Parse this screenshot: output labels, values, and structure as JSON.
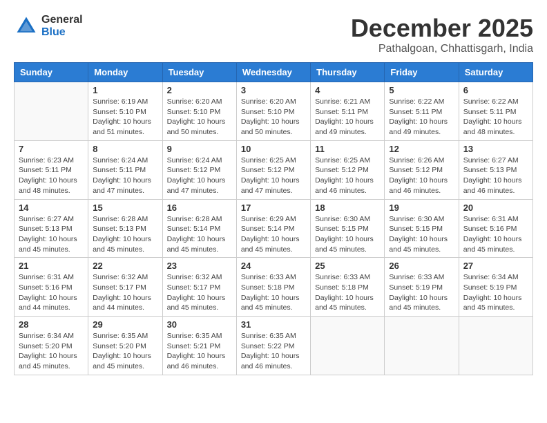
{
  "header": {
    "logo_general": "General",
    "logo_blue": "Blue",
    "month_title": "December 2025",
    "location": "Pathalgoan, Chhattisgarh, India"
  },
  "days_of_week": [
    "Sunday",
    "Monday",
    "Tuesday",
    "Wednesday",
    "Thursday",
    "Friday",
    "Saturday"
  ],
  "weeks": [
    [
      {
        "day": "",
        "info": ""
      },
      {
        "day": "1",
        "info": "Sunrise: 6:19 AM\nSunset: 5:10 PM\nDaylight: 10 hours\nand 51 minutes."
      },
      {
        "day": "2",
        "info": "Sunrise: 6:20 AM\nSunset: 5:10 PM\nDaylight: 10 hours\nand 50 minutes."
      },
      {
        "day": "3",
        "info": "Sunrise: 6:20 AM\nSunset: 5:10 PM\nDaylight: 10 hours\nand 50 minutes."
      },
      {
        "day": "4",
        "info": "Sunrise: 6:21 AM\nSunset: 5:11 PM\nDaylight: 10 hours\nand 49 minutes."
      },
      {
        "day": "5",
        "info": "Sunrise: 6:22 AM\nSunset: 5:11 PM\nDaylight: 10 hours\nand 49 minutes."
      },
      {
        "day": "6",
        "info": "Sunrise: 6:22 AM\nSunset: 5:11 PM\nDaylight: 10 hours\nand 48 minutes."
      }
    ],
    [
      {
        "day": "7",
        "info": "Sunrise: 6:23 AM\nSunset: 5:11 PM\nDaylight: 10 hours\nand 48 minutes."
      },
      {
        "day": "8",
        "info": "Sunrise: 6:24 AM\nSunset: 5:11 PM\nDaylight: 10 hours\nand 47 minutes."
      },
      {
        "day": "9",
        "info": "Sunrise: 6:24 AM\nSunset: 5:12 PM\nDaylight: 10 hours\nand 47 minutes."
      },
      {
        "day": "10",
        "info": "Sunrise: 6:25 AM\nSunset: 5:12 PM\nDaylight: 10 hours\nand 47 minutes."
      },
      {
        "day": "11",
        "info": "Sunrise: 6:25 AM\nSunset: 5:12 PM\nDaylight: 10 hours\nand 46 minutes."
      },
      {
        "day": "12",
        "info": "Sunrise: 6:26 AM\nSunset: 5:12 PM\nDaylight: 10 hours\nand 46 minutes."
      },
      {
        "day": "13",
        "info": "Sunrise: 6:27 AM\nSunset: 5:13 PM\nDaylight: 10 hours\nand 46 minutes."
      }
    ],
    [
      {
        "day": "14",
        "info": "Sunrise: 6:27 AM\nSunset: 5:13 PM\nDaylight: 10 hours\nand 45 minutes."
      },
      {
        "day": "15",
        "info": "Sunrise: 6:28 AM\nSunset: 5:13 PM\nDaylight: 10 hours\nand 45 minutes."
      },
      {
        "day": "16",
        "info": "Sunrise: 6:28 AM\nSunset: 5:14 PM\nDaylight: 10 hours\nand 45 minutes."
      },
      {
        "day": "17",
        "info": "Sunrise: 6:29 AM\nSunset: 5:14 PM\nDaylight: 10 hours\nand 45 minutes."
      },
      {
        "day": "18",
        "info": "Sunrise: 6:30 AM\nSunset: 5:15 PM\nDaylight: 10 hours\nand 45 minutes."
      },
      {
        "day": "19",
        "info": "Sunrise: 6:30 AM\nSunset: 5:15 PM\nDaylight: 10 hours\nand 45 minutes."
      },
      {
        "day": "20",
        "info": "Sunrise: 6:31 AM\nSunset: 5:16 PM\nDaylight: 10 hours\nand 45 minutes."
      }
    ],
    [
      {
        "day": "21",
        "info": "Sunrise: 6:31 AM\nSunset: 5:16 PM\nDaylight: 10 hours\nand 44 minutes."
      },
      {
        "day": "22",
        "info": "Sunrise: 6:32 AM\nSunset: 5:17 PM\nDaylight: 10 hours\nand 44 minutes."
      },
      {
        "day": "23",
        "info": "Sunrise: 6:32 AM\nSunset: 5:17 PM\nDaylight: 10 hours\nand 45 minutes."
      },
      {
        "day": "24",
        "info": "Sunrise: 6:33 AM\nSunset: 5:18 PM\nDaylight: 10 hours\nand 45 minutes."
      },
      {
        "day": "25",
        "info": "Sunrise: 6:33 AM\nSunset: 5:18 PM\nDaylight: 10 hours\nand 45 minutes."
      },
      {
        "day": "26",
        "info": "Sunrise: 6:33 AM\nSunset: 5:19 PM\nDaylight: 10 hours\nand 45 minutes."
      },
      {
        "day": "27",
        "info": "Sunrise: 6:34 AM\nSunset: 5:19 PM\nDaylight: 10 hours\nand 45 minutes."
      }
    ],
    [
      {
        "day": "28",
        "info": "Sunrise: 6:34 AM\nSunset: 5:20 PM\nDaylight: 10 hours\nand 45 minutes."
      },
      {
        "day": "29",
        "info": "Sunrise: 6:35 AM\nSunset: 5:20 PM\nDaylight: 10 hours\nand 45 minutes."
      },
      {
        "day": "30",
        "info": "Sunrise: 6:35 AM\nSunset: 5:21 PM\nDaylight: 10 hours\nand 46 minutes."
      },
      {
        "day": "31",
        "info": "Sunrise: 6:35 AM\nSunset: 5:22 PM\nDaylight: 10 hours\nand 46 minutes."
      },
      {
        "day": "",
        "info": ""
      },
      {
        "day": "",
        "info": ""
      },
      {
        "day": "",
        "info": ""
      }
    ]
  ]
}
